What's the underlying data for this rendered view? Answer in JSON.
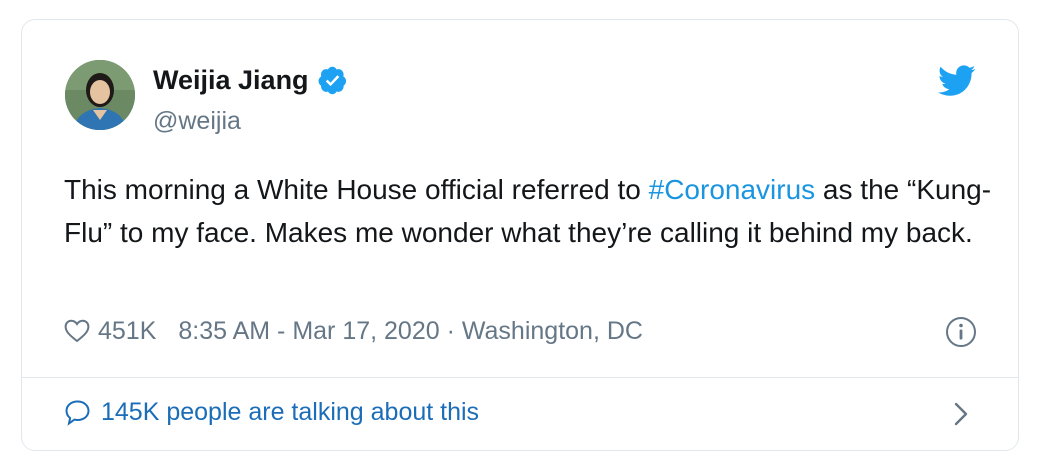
{
  "tweet": {
    "author_name": "Weijia Jiang",
    "author_handle": "@weijia",
    "text_before": "This morning a White House official referred to ",
    "hashtag": "#Coronavirus",
    "text_after": " as the “Kung-Flu” to my face. Makes me wonder what they’re calling it behind my back.",
    "likes": "451K",
    "timestamp_location": "8:35 AM - Mar 17, 2020 · Washington, DC",
    "conversation_label": "145K people are talking about this"
  },
  "icons": {
    "verified": "verified-badge-icon",
    "brand": "twitter-bird-icon",
    "like": "heart-icon",
    "info": "info-icon",
    "conversation": "speech-bubble-icon",
    "more": "chevron-right-icon"
  },
  "colors": {
    "brand_blue": "#1da1f2",
    "hashtag_blue": "#1b95e0",
    "link_blue": "#1b6db8",
    "secondary_text": "#657786",
    "border": "#e1e8ed"
  }
}
